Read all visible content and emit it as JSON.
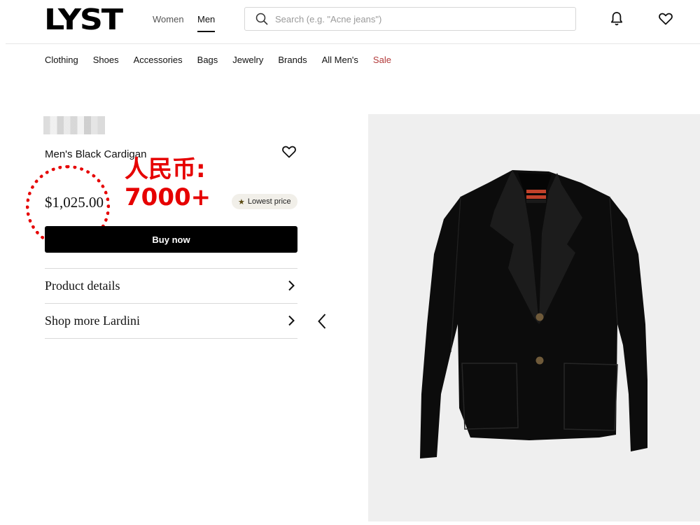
{
  "header": {
    "logo": "LYST",
    "gender_tabs": [
      {
        "label": "Women",
        "active": false
      },
      {
        "label": "Men",
        "active": true
      }
    ],
    "search_placeholder": "Search (e.g. \"Acne jeans\")",
    "icons": [
      "bell-icon",
      "heart-icon"
    ]
  },
  "categories": [
    "Clothing",
    "Shoes",
    "Accessories",
    "Bags",
    "Jewelry",
    "Brands",
    "All Men's",
    "Sale"
  ],
  "product": {
    "title": "Men's Black Cardigan",
    "price": "$1,025.00",
    "badge": "Lowest price",
    "buy_label": "Buy now",
    "accordions": [
      "Product details",
      "Shop more Lardini"
    ]
  },
  "annotation": {
    "line1": "人民币:",
    "line2": "7000+",
    "color": "#e60000"
  },
  "colors": {
    "sale": "#b23a3a",
    "button": "#000000",
    "image_bg": "#efefef"
  }
}
